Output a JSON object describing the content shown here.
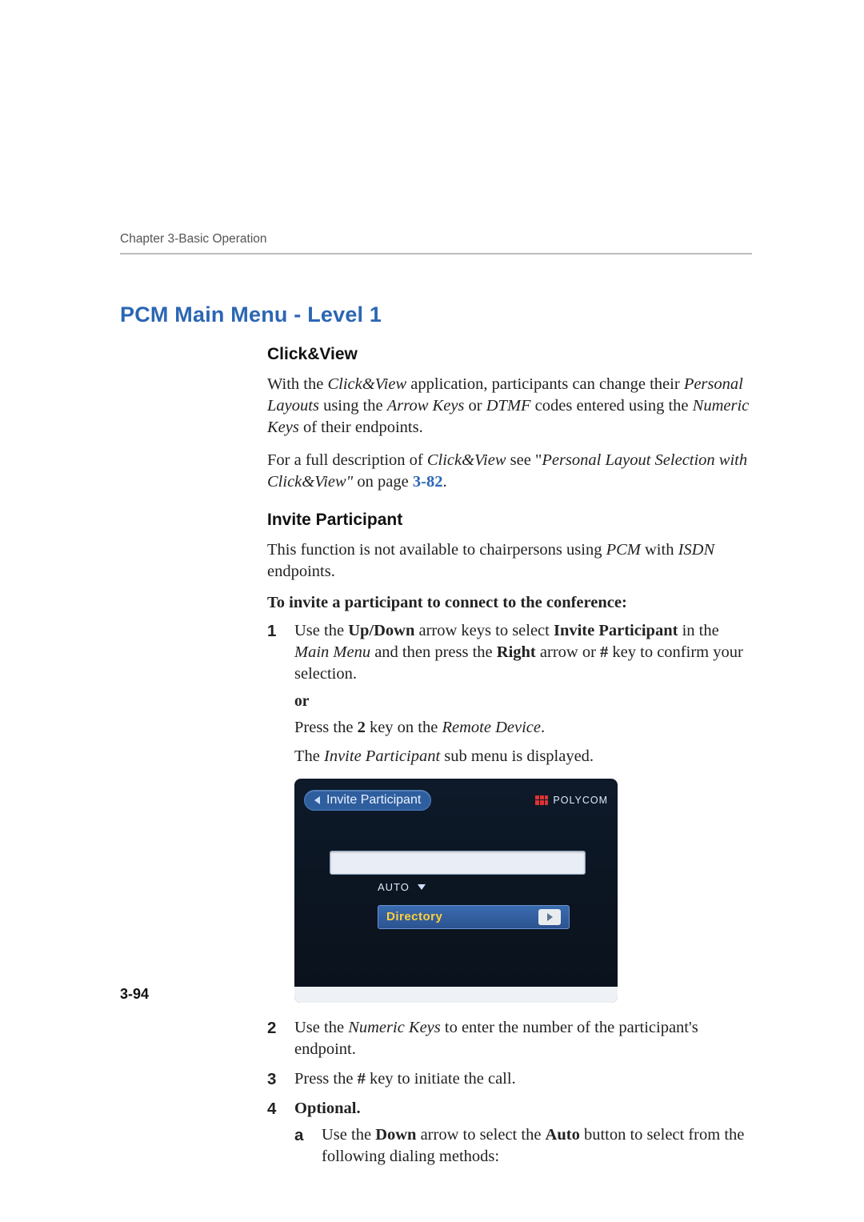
{
  "header": {
    "running": "Chapter 3-Basic Operation"
  },
  "title": "PCM Main Menu - Level 1",
  "clickview": {
    "heading": "Click&View",
    "p1_a": "With the ",
    "p1_b": "Click&View",
    "p1_c": " application, participants can change their ",
    "p1_d": "Personal Layouts",
    "p1_e": " using the ",
    "p1_f": "Arrow Keys",
    "p1_g": " or ",
    "p1_h": "DTMF",
    "p1_i": " codes entered using the ",
    "p1_j": "Numeric Keys",
    "p1_k": " of their endpoints.",
    "p2_a": "For a full description of ",
    "p2_b": "Click&View",
    "p2_c": " see \"",
    "p2_d": "Personal Layout Selection with Click&View\"",
    "p2_e": " on page ",
    "p2_xref": "3-82",
    "p2_f": "."
  },
  "invite": {
    "heading": "Invite Participant",
    "p1_a": "This function is not available to chairpersons using ",
    "p1_b": "PCM",
    "p1_c": " with ",
    "p1_d": "ISDN",
    "p1_e": " endpoints.",
    "instr": "To invite a participant to connect to the conference:"
  },
  "steps": {
    "s1_num": "1",
    "s1_a": "Use the ",
    "s1_b": "Up/Down",
    "s1_c": " arrow keys to select ",
    "s1_d": "Invite Participant",
    "s1_e": " in the ",
    "s1_f": "Main Menu",
    "s1_g": " and then press the ",
    "s1_h": "Right",
    "s1_i": " arrow or ",
    "s1_j": "#",
    "s1_k": " key to confirm your selection.",
    "or": "or",
    "s1_p2_a": "Press the ",
    "s1_p2_b": "2",
    "s1_p2_c": " key on the ",
    "s1_p2_d": "Remote Device",
    "s1_p2_e": ".",
    "s1_p3_a": "The ",
    "s1_p3_b": "Invite Participant",
    "s1_p3_c": " sub menu is displayed.",
    "s2_num": "2",
    "s2_a": "Use the ",
    "s2_b": "Numeric Keys",
    "s2_c": " to enter the number of the participant's endpoint.",
    "s3_num": "3",
    "s3_a": "Press the ",
    "s3_b": "#",
    "s3_c": " key to initiate the call.",
    "s4_num": "4",
    "s4_a": "Optional.",
    "s4a_alpha": "a",
    "s4a_a": "Use the ",
    "s4a_b": "Down",
    "s4a_c": " arrow to select the ",
    "s4a_d": "Auto",
    "s4a_e": " button to select from the following dialing methods:"
  },
  "screenshot": {
    "chip": "Invite Participant",
    "brand": "POLYCOM",
    "auto": "AUTO",
    "directory": "Directory"
  },
  "page_num": "3-94"
}
